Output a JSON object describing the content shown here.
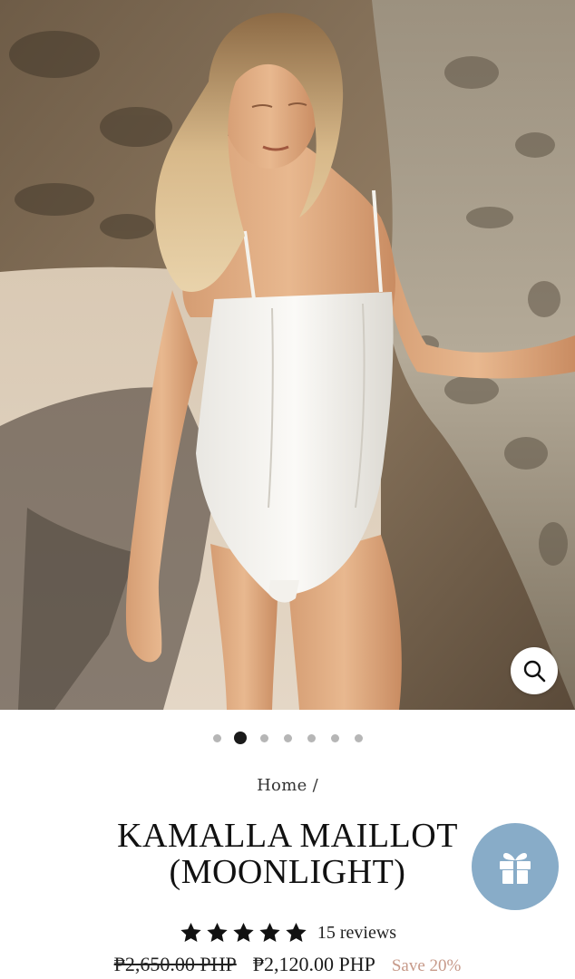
{
  "gallery": {
    "slide_count": 7,
    "active_index": 1,
    "zoom_icon": "search-icon"
  },
  "breadcrumb": {
    "home": "Home",
    "separator": "/"
  },
  "product": {
    "title_line1": "KAMALLA MAILLOT",
    "title_line2": "(MOONLIGHT)",
    "rating": 5,
    "reviews": "15 reviews",
    "old_price": "₱2,650.00 PHP",
    "price": "₱2,120.00 PHP",
    "save": "Save 20%"
  },
  "gift": {
    "icon": "gift-icon"
  },
  "colors": {
    "accent_blue": "#88acc8",
    "save_color": "#c79a8a",
    "dot_active": "#1a1a1a",
    "dot_inactive": "#b6b6b6"
  }
}
